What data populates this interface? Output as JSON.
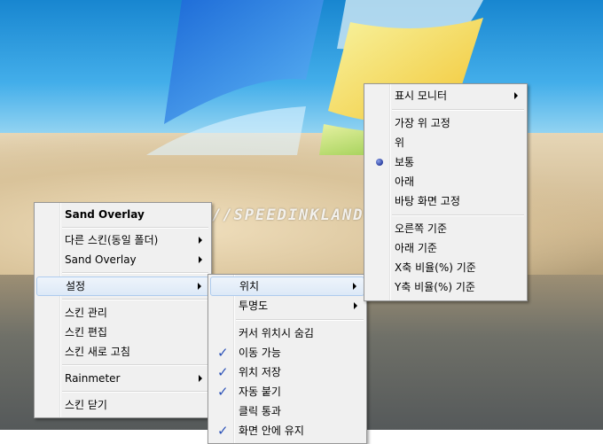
{
  "watermark": "HTTP://SPEEDINKLAND.COM",
  "main_menu": {
    "items": [
      {
        "label": "Sand Overlay",
        "bold": true
      },
      {
        "label": "다른 스킨(동일 폴더)",
        "submenu": true
      },
      {
        "label": "Sand Overlay",
        "submenu": true
      },
      {
        "label": "설정",
        "submenu": true,
        "highlighted": true
      },
      {
        "label": "스킨 관리"
      },
      {
        "label": "스킨 편집"
      },
      {
        "label": "스킨 새로 고침"
      },
      {
        "label": "Rainmeter",
        "submenu": true
      },
      {
        "label": "스킨 닫기"
      }
    ]
  },
  "settings_menu": {
    "items": [
      {
        "label": "위치",
        "submenu": true,
        "highlighted": true
      },
      {
        "label": "투명도",
        "submenu": true
      },
      {
        "label": "커서 위치시 숨김"
      },
      {
        "label": "이동 가능",
        "checked": true
      },
      {
        "label": "위치 저장",
        "checked": true
      },
      {
        "label": "자동 붙기",
        "checked": true
      },
      {
        "label": "클릭 통과"
      },
      {
        "label": "화면 안에 유지",
        "checked": true
      }
    ]
  },
  "position_menu": {
    "items": [
      {
        "label": "표시 모니터",
        "submenu": true
      },
      {
        "label": "가장 위 고정"
      },
      {
        "label": "위"
      },
      {
        "label": "보통",
        "selected": true
      },
      {
        "label": "아래"
      },
      {
        "label": "바탕 화면 고정"
      },
      {
        "label": "오른쪽 기준"
      },
      {
        "label": "아래 기준"
      },
      {
        "label": "X축 비율(%) 기준"
      },
      {
        "label": "Y축 비율(%) 기준"
      }
    ]
  },
  "colors": {
    "check": "#2c52b8",
    "highlight": "#dde9f7",
    "menu_bg": "#f0f0f0"
  }
}
